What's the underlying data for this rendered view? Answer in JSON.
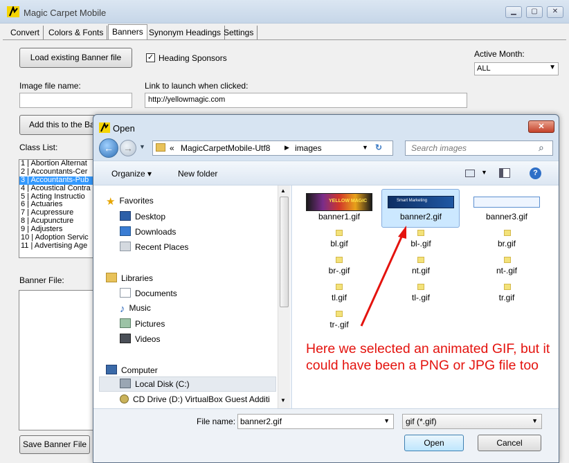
{
  "window": {
    "title": "Magic Carpet Mobile"
  },
  "tabs": [
    "Convert",
    "Colors & Fonts",
    "Banners",
    "Synonym Headings",
    "Settings"
  ],
  "banners": {
    "load_button": "Load existing Banner file",
    "heading_sponsors_label": "Heading Sponsors",
    "heading_sponsors_checked": "✓",
    "active_month_label": "Active Month:",
    "active_month_value": "ALL",
    "image_file_label": "Image file name:",
    "image_file_value": "",
    "link_label": "Link to launch when clicked:",
    "link_value": "http://yellowmagic.com",
    "add_button": "Add this to the Ba",
    "class_list_label": "Class List:",
    "class_list": [
      "1 | Abortion Alternat",
      "2 | Accountants-Cer",
      "3 | Accountants-Pub",
      "4 | Acoustical Contra",
      "5 | Acting Instructio",
      "6 | Actuaries",
      "7 | Acupressure",
      "8 | Acupuncture",
      "9 | Adjusters",
      "10 | Adoption Servic",
      "11 | Advertising Age"
    ],
    "banner_file_label": "Banner File:",
    "save_button": "Save Banner File"
  },
  "dialog": {
    "title": "Open",
    "address": {
      "prefix": "«",
      "path": [
        "MagicCarpetMobile-Utf8",
        "images"
      ]
    },
    "search_placeholder": "Search images",
    "organize": "Organize ▾",
    "new_folder": "New folder",
    "nav": {
      "favorites": "Favorites",
      "desktop": "Desktop",
      "downloads": "Downloads",
      "recent_places": "Recent Places",
      "libraries": "Libraries",
      "documents": "Documents",
      "music": "Music",
      "pictures": "Pictures",
      "videos": "Videos",
      "computer": "Computer",
      "local_disk": "Local Disk (C:)",
      "cd_drive": "CD Drive (D:) VirtualBox Guest Additi"
    },
    "files": {
      "banner1": "banner1.gif",
      "banner2": "banner2.gif",
      "banner3": "banner3.gif",
      "bl": "bl.gif",
      "bl_": "bl-.gif",
      "br": "br.gif",
      "br_": "br-.gif",
      "nt": "nt.gif",
      "nt_": "nt-.gif",
      "tl": "tl.gif",
      "tl_": "tl-.gif",
      "tr": "tr.gif",
      "tr_": "tr-.gif"
    },
    "thumb_text": {
      "banner1": "YELLOW MAGIC",
      "banner2": "Smart Marketing",
      "banner3": ""
    },
    "file_name_label": "File name:",
    "file_name_value": "banner2.gif",
    "filter_value": "gif (*.gif)",
    "open_button": "Open",
    "cancel_button": "Cancel"
  },
  "annotation": {
    "text": "Here we selected an animated GIF, but it could have been a PNG or JPG file too",
    "color": "#e4130e"
  },
  "colors": {
    "selection": "#3399ff",
    "file_selection": "#cce8ff"
  }
}
